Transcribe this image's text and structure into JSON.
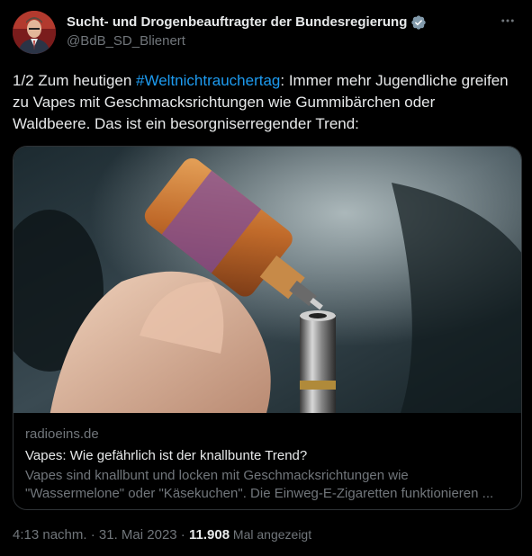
{
  "author": {
    "display_name": "Sucht- und Drogenbeauftragter der Bundesregierung",
    "handle": "@BdB_SD_Blienert",
    "verified_badge_icon": "gray-verified-badge-icon",
    "verified_color": "#829aab"
  },
  "menu": {
    "icon": "more-horizontal-icon"
  },
  "tweet": {
    "text_before": "1/2 Zum heutigen ",
    "hashtag": "#Weltnichtrauchertag",
    "text_after": ": Immer mehr Jugendliche greifen zu Vapes mit Geschmacksrichtungen wie Gummibärchen oder Waldbeere. Das ist ein besorgniserregender Trend:"
  },
  "card": {
    "domain": "radioeins.de",
    "title": "Vapes: Wie gefährlich ist der knallbunte Trend?",
    "description": "Vapes sind knallbunt und locken mit Geschmacksrichtungen wie \"Wassermelone\" oder \"Käsekuchen\". Die Einweg-E-Zigaretten funktionieren ..."
  },
  "footer": {
    "time": "4:13 nachm.",
    "sep1": " · ",
    "date": "31. Mai 2023",
    "sep2": " · ",
    "views": "11.908",
    "views_label": " Mal angezeigt"
  },
  "colors": {
    "background": "#000000",
    "text": "#e7e9ea",
    "muted": "#71767b",
    "link": "#1d9bf0",
    "border": "#2f3336"
  }
}
